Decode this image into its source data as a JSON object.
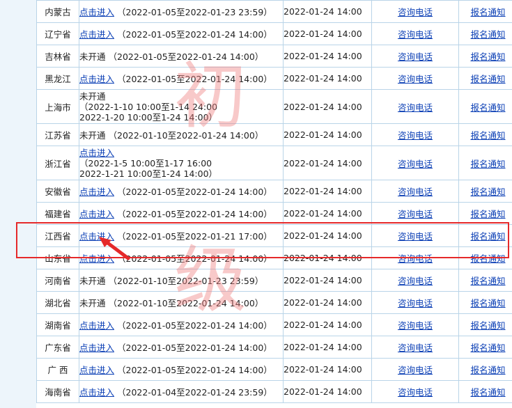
{
  "watermark": {
    "char1": "初",
    "char2": "级"
  },
  "rows": [
    {
      "province": "内蒙古",
      "status": "点击进入",
      "status_link": true,
      "date_range": "（2022-01-05至2022-01-23 23:59）",
      "exam_time": "2022-01-24 14:00",
      "phone": "咨询电话",
      "notice": "报名通知"
    },
    {
      "province": "辽宁省",
      "status": "点击进入",
      "status_link": true,
      "date_range": "（2022-01-05至2022-01-24 14:00）",
      "exam_time": "2022-01-24 14:00",
      "phone": "咨询电话",
      "notice": "报名通知"
    },
    {
      "province": "吉林省",
      "status": "未开通",
      "status_link": false,
      "date_range": "（2022-01-05至2022-01-24 14:00）",
      "exam_time": "2022-01-24 14:00",
      "phone": "咨询电话",
      "notice": "报名通知"
    },
    {
      "province": "黑龙江",
      "status": "点击进入",
      "status_link": true,
      "date_range": "（2022-01-05至2022-01-24 14:00）",
      "exam_time": "2022-01-24 14:00",
      "phone": "咨询电话",
      "notice": "报名通知"
    },
    {
      "province": "上海市",
      "status": "未开通",
      "status_link": false,
      "line2": "（2022-1-10 10:00至1-14 24:00",
      "line3": "2022-1-20 10:00至1-24 14:00）",
      "exam_time": "2022-01-24 14:00",
      "phone": "咨询电话",
      "notice": "报名通知"
    },
    {
      "province": "江苏省",
      "status": "未开通",
      "status_link": false,
      "date_range": "（2022-01-10至2022-01-24 14:00）",
      "exam_time": "2022-01-24 14:00",
      "phone": "咨询电话",
      "notice": "报名通知"
    },
    {
      "province": "浙江省",
      "status": "点击进入",
      "status_link": true,
      "line2": "（2022-1-5 10:00至1-17 16:00",
      "line3": "2022-1-21 10:00至1-24 14:00）",
      "exam_time": "2022-01-24 14:00",
      "phone": "咨询电话",
      "notice": "报名通知"
    },
    {
      "province": "安徽省",
      "status": "点击进入",
      "status_link": true,
      "date_range": "（2022-01-05至2022-01-24 14:00）",
      "exam_time": "2022-01-24 14:00",
      "phone": "咨询电话",
      "notice": "报名通知"
    },
    {
      "province": "福建省",
      "status": "点击进入",
      "status_link": true,
      "date_range": "（2022-01-05至2022-01-24 14:00）",
      "exam_time": "2022-01-24 14:00",
      "phone": "咨询电话",
      "notice": "报名通知"
    },
    {
      "province": "江西省",
      "status": "点击进入",
      "status_link": true,
      "date_range": "（2022-01-05至2022-01-21 17:00）",
      "exam_time": "2022-01-24 14:00",
      "phone": "咨询电话",
      "notice": "报名通知"
    },
    {
      "province": "山东省",
      "status": "点击进入",
      "status_link": true,
      "date_range": "（2022-01-05至2022-01-24 14:00）",
      "exam_time": "2022-01-24 14:00",
      "phone": "咨询电话",
      "notice": "报名通知"
    },
    {
      "province": "河南省",
      "status": "未开通",
      "status_link": false,
      "date_range": "（2022-01-10至2022-01-23 23:59）",
      "exam_time": "2022-01-24 14:00",
      "phone": "咨询电话",
      "notice": "报名通知"
    },
    {
      "province": "湖北省",
      "status": "未开通",
      "status_link": false,
      "date_range": "（2022-01-10至2022-01-24 14:00）",
      "exam_time": "2022-01-24 14:00",
      "phone": "咨询电话",
      "notice": "报名通知"
    },
    {
      "province": "湖南省",
      "status": "点击进入",
      "status_link": true,
      "date_range": "（2022-01-05至2022-01-24 14:00）",
      "exam_time": "2022-01-24 14:00",
      "phone": "咨询电话",
      "notice": "报名通知"
    },
    {
      "province": "广东省",
      "status": "点击进入",
      "status_link": true,
      "date_range": "（2022-01-05至2022-01-24 14:00）",
      "exam_time": "2022-01-24 14:00",
      "phone": "咨询电话",
      "notice": "报名通知"
    },
    {
      "province": "广 西",
      "status": "点击进入",
      "status_link": true,
      "date_range": "（2022-01-05至2022-01-24 14:00）",
      "exam_time": "2022-01-24 14:00",
      "phone": "咨询电话",
      "notice": "报名通知"
    },
    {
      "province": "海南省",
      "status": "点击进入",
      "status_link": true,
      "date_range": "（2022-01-04至2022-01-24 23:59）",
      "exam_time": "2022-01-24 14:00",
      "phone": "咨询电话",
      "notice": "报名通知"
    }
  ],
  "highlight": {
    "row_index": 9,
    "color": "#e5292a"
  },
  "colors": {
    "link": "#0b3fb5",
    "border": "#b9d4e8",
    "watermark": "#f07f7f",
    "page_bg": "#edf5fb"
  }
}
